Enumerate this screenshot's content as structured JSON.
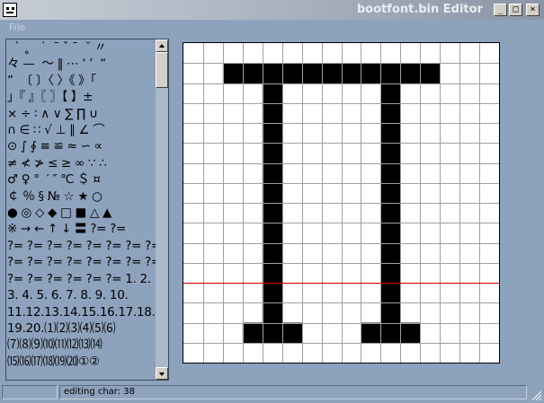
{
  "window": {
    "title": "bootfont.bin Editor",
    "app_icon": "smiley-face-icon",
    "controls": {
      "minimize": "_",
      "maximize": "□",
      "close": "×"
    }
  },
  "menu": {
    "file": "File"
  },
  "char_list": {
    "rows": [
      "  ˋ ˳   ˙  ˉ ˇ ˉ  ˘ 〃",
      "々 —  ～ ‖ ⋯ ‘ ’  “",
      "”  〔 〕〈 〉《 》「",
      "」『 』〖 〗【 】±",
      "× ÷ ∶ ∧ ∨ ∑ ∏ ∪",
      "∩ ∈ ∷ √ ⊥ ∥ ∠ ⌒",
      "⊙ ∫ ∮ ≡ ≌ ≈ ∽ ∝",
      "≠ ≮ ≯ ≤ ≥ ∞ ∵ ∴",
      "♂ ♀ °  ′ ″ ℃ ＄ ¤",
      "￠ ％ § № ☆ ★ ○",
      "● ◎ ◇ ◆ □ ■ △ ▲",
      "※ → ← ↑ ↓ 〓 ?= ?=",
      "?= ?= ?= ?= ?= ?= ?= ?=",
      "?= ?= ?= ?= ?= ?= ?= ?=",
      "?= ?= ?= ?= ?= ?= 1. 2.",
      "3. 4. 5. 6. 7. 8. 9. 10.",
      "11.12.13.14.15.16.17.18.",
      "19.20.⑴⑵⑶⑷⑸⑹",
      "⑺⑻⑼⑽⑾⑿⒀⒁",
      "⒂⒃⒄⒅⒆⒇①②"
    ]
  },
  "scrollbar": {
    "up": "scroll-up-arrow-icon",
    "down": "scroll-down-arrow-icon",
    "position": 0.0
  },
  "editor": {
    "cols": 16,
    "rows": 16,
    "baseline_row": 12,
    "baseline_color": "#cc0000",
    "grid_color": "#a0a0a0",
    "pixel_color": "#000000",
    "pixels": [
      "................",
      "..###########...",
      "....#.....#.....",
      "....#.....#.....",
      "....#.....#.....",
      "....#.....#.....",
      "....#.....#.....",
      "....#.....#.....",
      "....#.....#.....",
      "....#.....#.....",
      "....#.....#.....",
      "....#.....#.....",
      "....#.....#.....",
      "....#.....#.....",
      "...###...###....",
      "................"
    ]
  },
  "status": {
    "left": "",
    "text": "editing char: 38"
  },
  "colors": {
    "titlebar_text": "#e9edf2",
    "window_bg": "#8da2bd",
    "menu_text": "#c8d3e0"
  }
}
